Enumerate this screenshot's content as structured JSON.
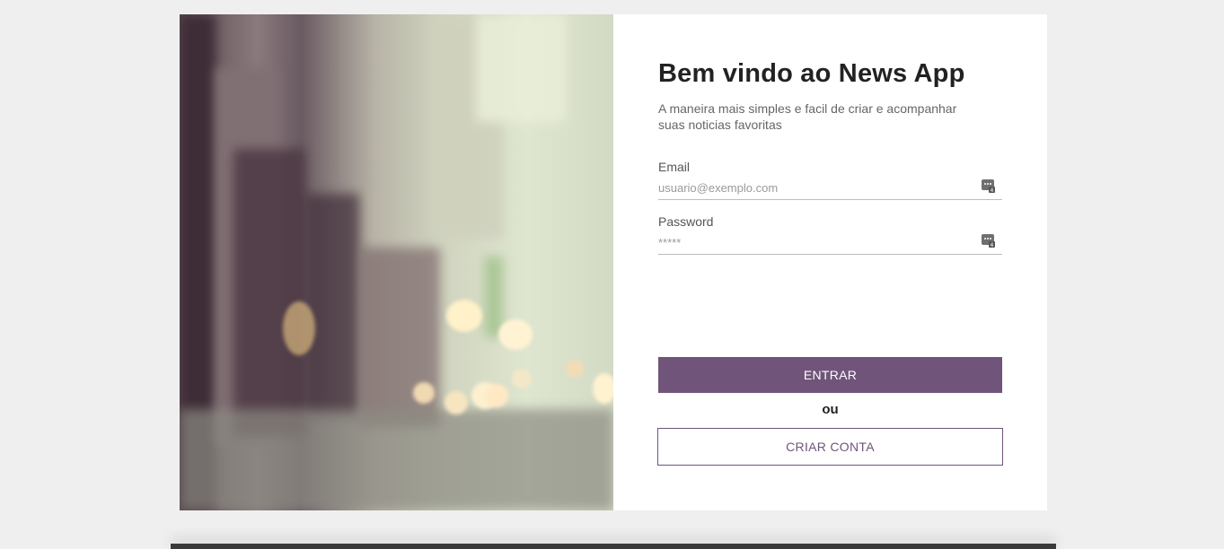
{
  "welcome": {
    "title": "Bem vindo ao News App",
    "subtitle": "A maneira mais simples e facil de criar e acompanhar suas noticias favoritas"
  },
  "form": {
    "email_label": "Email",
    "email_placeholder": "usuario@exemplo.com",
    "password_label": "Password",
    "password_placeholder": "*****",
    "field_icon": "password-manager-key-icon"
  },
  "actions": {
    "login_label": "ENTRAR",
    "or_label": "ou",
    "signup_label": "CRIAR CONTA"
  },
  "colors": {
    "accent": "#70547a",
    "background": "#efefef"
  }
}
